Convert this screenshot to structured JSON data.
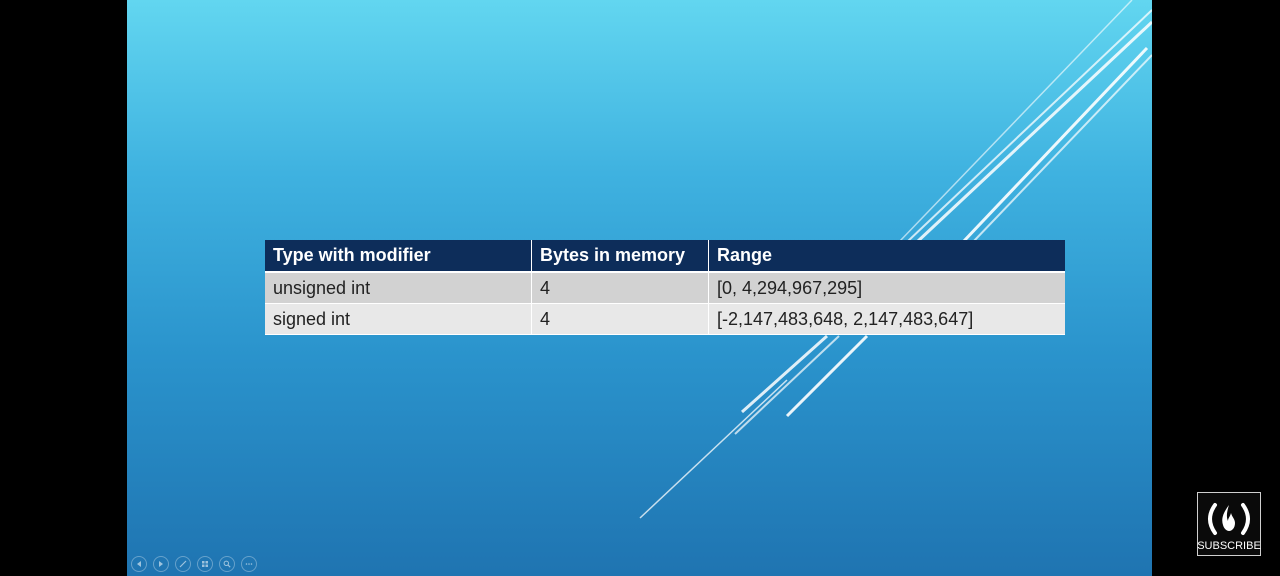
{
  "table": {
    "headers": [
      "Type with modifier",
      "Bytes in memory",
      "Range"
    ],
    "rows": [
      [
        "unsigned int",
        "4",
        "[0, 4,294,967,295]"
      ],
      [
        "signed int",
        "4",
        "[-2,147,483,648, 2,147,483,647]"
      ]
    ]
  },
  "subscribe": {
    "label": "SUBSCRIBE"
  },
  "navigation": {
    "buttons": [
      "previous-icon",
      "next-icon",
      "pen-icon",
      "slides-grid-icon",
      "zoom-icon",
      "more-icon"
    ]
  },
  "colors": {
    "header_bg": "#0d2d5a",
    "row_odd_bg": "#d2d2d2",
    "row_even_bg": "#e8e8e8",
    "slide_top": "#62d6f0",
    "slide_bottom": "#1f74b1"
  }
}
